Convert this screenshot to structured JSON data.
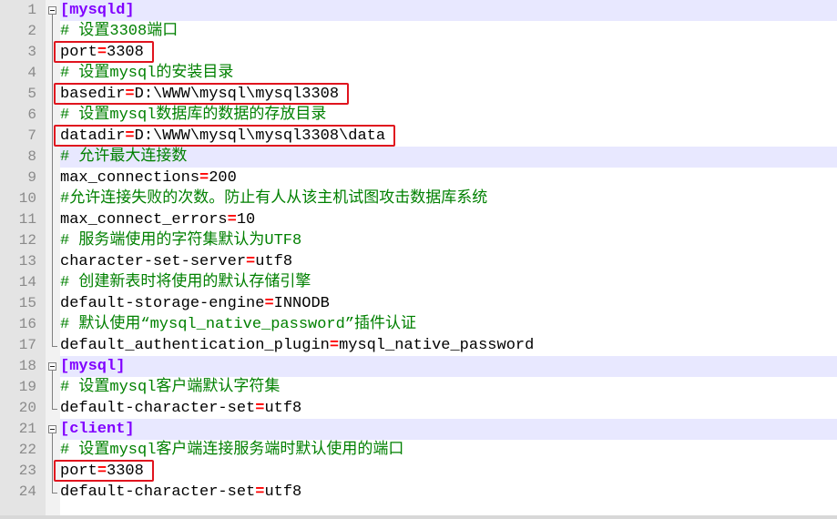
{
  "editor": {
    "line_numbers": [
      "1",
      "2",
      "3",
      "4",
      "5",
      "6",
      "7",
      "8",
      "9",
      "10",
      "11",
      "12",
      "13",
      "14",
      "15",
      "16",
      "17",
      "18",
      "19",
      "20",
      "21",
      "22",
      "23",
      "24"
    ],
    "lines": [
      {
        "type": "section",
        "text": "[mysqld]"
      },
      {
        "type": "comment",
        "text": "# 设置3308端口"
      },
      {
        "type": "kv",
        "key": "port",
        "eq": "=",
        "value": "3308"
      },
      {
        "type": "comment",
        "text": "# 设置mysql的安装目录"
      },
      {
        "type": "kv",
        "key": "basedir",
        "eq": "=",
        "value": "D:\\WWW\\mysql\\mysql3308"
      },
      {
        "type": "comment",
        "text": "# 设置mysql数据库的数据的存放目录"
      },
      {
        "type": "kv",
        "key": "datadir",
        "eq": "=",
        "value": "D:\\WWW\\mysql\\mysql3308\\data"
      },
      {
        "type": "comment",
        "text": "# 允许最大连接数"
      },
      {
        "type": "kv",
        "key": "max_connections",
        "eq": "=",
        "value": "200"
      },
      {
        "type": "comment",
        "text": "#允许连接失败的次数。防止有人从该主机试图攻击数据库系统"
      },
      {
        "type": "kv",
        "key": "max_connect_errors",
        "eq": "=",
        "value": "10"
      },
      {
        "type": "comment",
        "text": "# 服务端使用的字符集默认为UTF8"
      },
      {
        "type": "kv",
        "key": "character-set-server",
        "eq": "=",
        "value": "utf8"
      },
      {
        "type": "comment",
        "text": "# 创建新表时将使用的默认存储引擎"
      },
      {
        "type": "kv",
        "key": "default-storage-engine",
        "eq": "=",
        "value": "INNODB"
      },
      {
        "type": "comment",
        "text": "# 默认使用“mysql_native_password”插件认证"
      },
      {
        "type": "kv",
        "key": "default_authentication_plugin",
        "eq": "=",
        "value": "mysql_native_password"
      },
      {
        "type": "section",
        "text": "[mysql]"
      },
      {
        "type": "comment",
        "text": "# 设置mysql客户端默认字符集"
      },
      {
        "type": "kv",
        "key": "default-character-set",
        "eq": "=",
        "value": "utf8"
      },
      {
        "type": "section",
        "text": "[client]"
      },
      {
        "type": "comment",
        "text": "# 设置mysql客户端连接服务端时默认使用的端口"
      },
      {
        "type": "kv",
        "key": "port",
        "eq": "=",
        "value": "3308"
      },
      {
        "type": "kv",
        "key": "default-character-set",
        "eq": "=",
        "value": "utf8"
      }
    ],
    "highlighted_lines": [
      1,
      8,
      18,
      21
    ],
    "annotated_lines": [
      3,
      5,
      7,
      23
    ]
  },
  "colors": {
    "section": "#8000ff",
    "comment": "#008000",
    "operator": "#ff0000",
    "annotation_box": "#e0141e",
    "gutter": "#e4e4e4",
    "current_line": "#e8e8ff"
  }
}
